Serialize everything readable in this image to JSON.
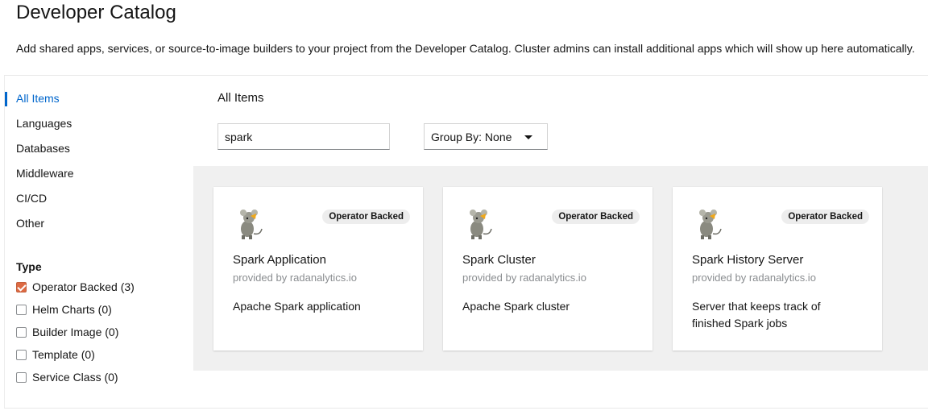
{
  "header": {
    "title": "Developer Catalog",
    "description": "Add shared apps, services, or source-to-image builders to your project from the Developer Catalog. Cluster admins can install additional apps which will show up here automatically."
  },
  "sidebar": {
    "items": [
      {
        "label": "All Items",
        "active": true
      },
      {
        "label": "Languages"
      },
      {
        "label": "Databases"
      },
      {
        "label": "Middleware"
      },
      {
        "label": "CI/CD"
      },
      {
        "label": "Other"
      }
    ],
    "type_heading": "Type",
    "filters": [
      {
        "label": "Operator Backed (3)",
        "checked": true
      },
      {
        "label": "Helm Charts (0)",
        "checked": false
      },
      {
        "label": "Builder Image (0)",
        "checked": false
      },
      {
        "label": "Template (0)",
        "checked": false
      },
      {
        "label": "Service Class (0)",
        "checked": false
      }
    ]
  },
  "main": {
    "title": "All Items",
    "search": {
      "value": "spark"
    },
    "group_by": {
      "label": "Group By: None"
    },
    "cards": [
      {
        "badge": "Operator Backed",
        "name": "Spark Application",
        "provider": "provided by radanalytics.io",
        "description": "Apache Spark application"
      },
      {
        "badge": "Operator Backed",
        "name": "Spark Cluster",
        "provider": "provided by radanalytics.io",
        "description": "Apache Spark cluster"
      },
      {
        "badge": "Operator Backed",
        "name": "Spark History Server",
        "provider": "provided by radanalytics.io",
        "description": "Server that keeps track of finished Spark jobs"
      }
    ]
  },
  "colors": {
    "accent": "#0066cc",
    "checkbox_checked": "#dd6a43",
    "grid_background": "#f0f0f0"
  }
}
